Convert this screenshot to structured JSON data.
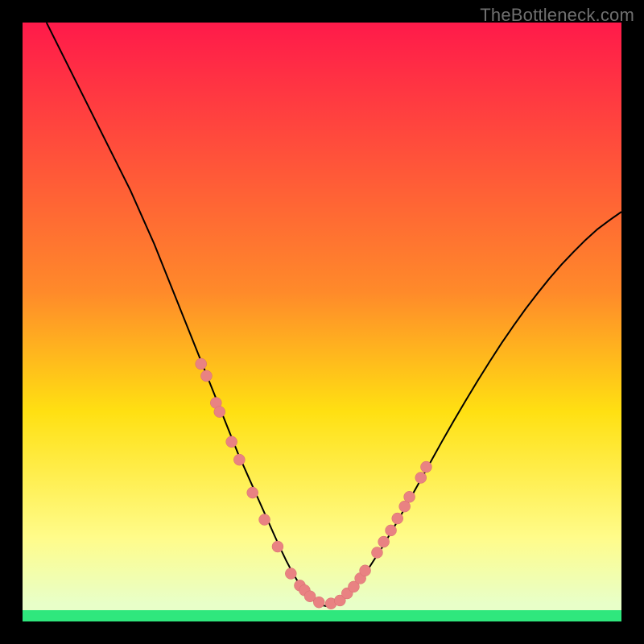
{
  "credit": "TheBottleneck.com",
  "colors": {
    "frame": "#000000",
    "curve": "#000000",
    "dots": "#e98282",
    "dotStroke": "#d66f6f",
    "greenBand": "#2fe77d",
    "gradientTop": "#ff1a4a",
    "gradientMid1": "#ff8a2a",
    "gradientMid2": "#ffe012",
    "gradientLower": "#fffc8a",
    "gradientBottom": "#e8ffc8"
  },
  "chart_data": {
    "type": "line",
    "title": "",
    "xlabel": "",
    "ylabel": "",
    "xlim": [
      0,
      100
    ],
    "ylim": [
      0,
      100
    ],
    "curve": {
      "x": [
        4,
        6,
        8,
        10,
        12,
        14,
        16,
        18,
        20,
        22,
        24,
        26,
        28,
        30,
        32,
        34,
        36,
        38,
        40,
        42,
        43,
        44,
        45,
        46,
        47,
        48,
        49,
        50,
        51,
        52,
        53,
        54,
        56,
        58,
        60,
        62,
        64,
        66,
        68,
        70,
        72,
        74,
        76,
        78,
        80,
        82,
        84,
        86,
        88,
        90,
        92,
        94,
        96,
        98,
        100
      ],
      "y": [
        100,
        96,
        92,
        88,
        84,
        80,
        76,
        72,
        67.5,
        63,
        58,
        53,
        48,
        43,
        38,
        33,
        28,
        23.5,
        19,
        14.5,
        12.3,
        10.2,
        8.3,
        6.6,
        5.2,
        4.0,
        3.2,
        2.7,
        2.5,
        2.7,
        3.3,
        4.2,
        6.5,
        9.2,
        12.3,
        15.7,
        19.2,
        22.8,
        26.4,
        30.0,
        33.5,
        36.9,
        40.2,
        43.4,
        46.5,
        49.4,
        52.2,
        54.8,
        57.3,
        59.6,
        61.7,
        63.7,
        65.5,
        67.0,
        68.4
      ]
    },
    "dots": [
      {
        "x": 29.8,
        "y": 43.0
      },
      {
        "x": 30.7,
        "y": 41.0
      },
      {
        "x": 32.3,
        "y": 36.5
      },
      {
        "x": 32.9,
        "y": 35.0
      },
      {
        "x": 34.9,
        "y": 30.0
      },
      {
        "x": 36.2,
        "y": 27.0
      },
      {
        "x": 38.4,
        "y": 21.5
      },
      {
        "x": 40.4,
        "y": 17.0
      },
      {
        "x": 42.6,
        "y": 12.5
      },
      {
        "x": 44.8,
        "y": 8.0
      },
      {
        "x": 46.3,
        "y": 6.0
      },
      {
        "x": 47.1,
        "y": 5.2
      },
      {
        "x": 48.0,
        "y": 4.2
      },
      {
        "x": 49.5,
        "y": 3.2
      },
      {
        "x": 51.5,
        "y": 3.0
      },
      {
        "x": 53.0,
        "y": 3.5
      },
      {
        "x": 54.2,
        "y": 4.7
      },
      {
        "x": 55.3,
        "y": 5.8
      },
      {
        "x": 56.4,
        "y": 7.2
      },
      {
        "x": 57.2,
        "y": 8.5
      },
      {
        "x": 59.2,
        "y": 11.5
      },
      {
        "x": 60.3,
        "y": 13.3
      },
      {
        "x": 61.5,
        "y": 15.2
      },
      {
        "x": 62.6,
        "y": 17.2
      },
      {
        "x": 63.8,
        "y": 19.2
      },
      {
        "x": 64.6,
        "y": 20.8
      },
      {
        "x": 66.5,
        "y": 24.0
      },
      {
        "x": 67.4,
        "y": 25.8
      }
    ]
  }
}
